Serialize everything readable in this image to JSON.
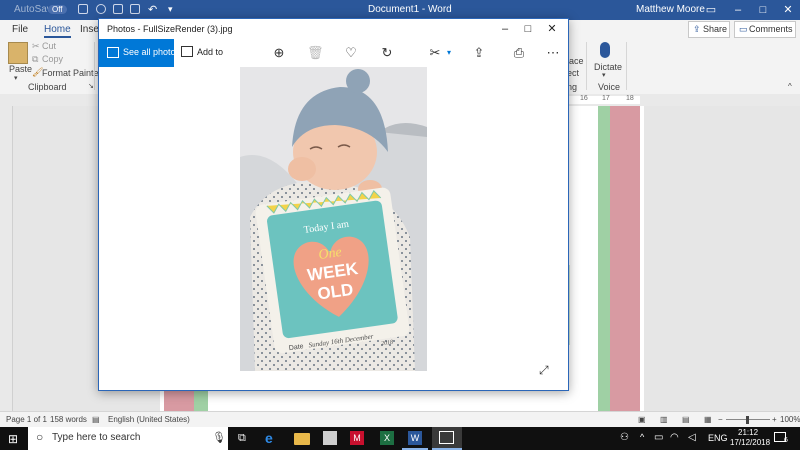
{
  "word": {
    "autosave_label": "AutoSave",
    "autosave_state": "Off",
    "document_title": "Document1 - Word",
    "user_name": "Matthew Moore",
    "tabs": [
      "File",
      "Home",
      "Inser"
    ],
    "active_tab": "Home",
    "share_label": "Share",
    "comments_label": "Comments",
    "ribbon": {
      "paste_label": "Paste",
      "cut_label": "Cut",
      "copy_label": "Copy",
      "format_painter_label": "Format Painter",
      "clipboard_group_label": "Clipboard",
      "replace_partial": "lace",
      "select_partial": "ect",
      "editing_group_partial": "ng",
      "dictate_label": "Dictate",
      "voice_group_label": "Voice"
    },
    "ruler_numbers": [
      "16",
      "17",
      "18"
    ],
    "status": {
      "page": "Page 1 of 1",
      "words": "158 words",
      "language": "English (United States)",
      "zoom": "100%"
    },
    "accent_color": "#2b579a"
  },
  "photos": {
    "window_title": "Photos - FullSizeRender (3).jpg",
    "see_all_label": "See all photos",
    "add_to_label": "Add to",
    "accent_color": "#0078d7",
    "toolbar_icons": [
      "zoom-in-icon",
      "delete-icon",
      "heart-icon",
      "rotate-icon",
      "edit-icon",
      "share-icon",
      "print-icon",
      "more-icon"
    ],
    "photo": {
      "sign_top_text": "Today I am",
      "sign_line1": "One",
      "sign_line2": "WEEK",
      "sign_line3": "OLD",
      "sign_date_label": "Date",
      "sign_date_value": "Sunday 16th December",
      "sign_year": "2018"
    }
  },
  "taskbar": {
    "search_placeholder": "Type here to search",
    "language": "ENG",
    "time": "21:12",
    "date": "17/12/2018",
    "notification_count": "6"
  }
}
